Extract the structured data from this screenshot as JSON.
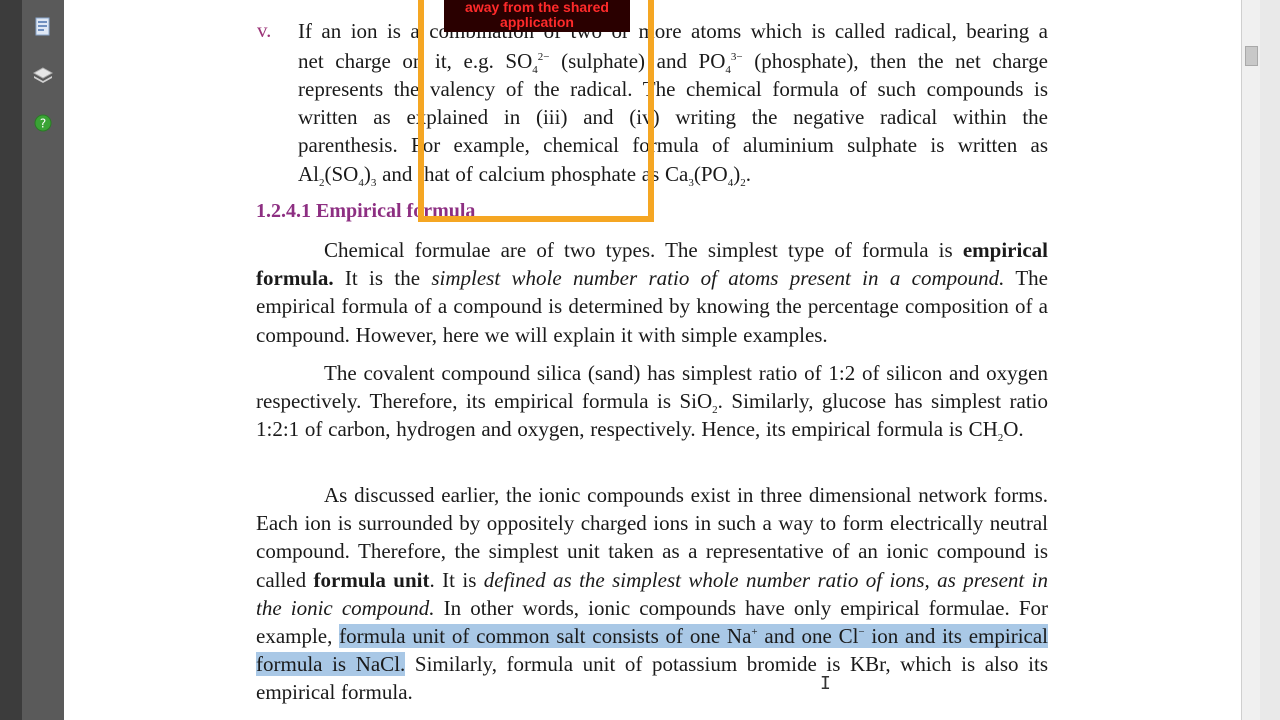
{
  "toolbar": {
    "icons": [
      "page-thumbnails-icon",
      "layers-icon",
      "help-icon"
    ]
  },
  "overlay": {
    "label_line1": "away from the shared",
    "label_line2": "application"
  },
  "item_v": {
    "marker": "v.",
    "l1": "If an ion is a combination of two or more atoms which is called radical, bearing a",
    "l2a": "net charge on it, e.g. SO",
    "l2_sub": "4",
    "l2_sup": "2−",
    "l2b": " (sulphate) and PO",
    "l2_sub2": "4",
    "l2_sup2": "3−",
    "l2c": " (phosphate), then the net charge",
    "l3": "represents the valency of the radical. The chemical formula of such compounds is",
    "l4": "written as explained in (iii) and (iv) writing the negative radical within the",
    "l5": "parenthesis. For example, chemical formula of aluminium sulphate is written as",
    "l6a": "Al",
    "l6_sub1": "2",
    "l6b": "(SO",
    "l6_sub2": "4",
    "l6c": ")",
    "l6_sub3": "3",
    "l6d": " and that of calcium phosphate as Ca",
    "l6_sub4": "3",
    "l6e": "(PO",
    "l6_sub5": "4",
    "l6f": ")",
    "l6_sub6": "2",
    "l6g": "."
  },
  "heading": "1.2.4.1 Empirical formula",
  "p1": {
    "a": "Chemical formulae are of two types. The simplest type of formula is ",
    "b": "empirical formula.",
    "c": " It is the ",
    "d": "simplest whole number ratio of atoms present in a compound.",
    "e": " The empirical formula of a compound is determined by knowing the percentage composition of a compound. However, here we will explain it with simple examples."
  },
  "p2": {
    "a": "The covalent compound silica (sand) has simplest ratio of 1:2 of silicon and oxygen respectively. Therefore, its empirical formula is SiO",
    "sub1": "2",
    "b": ". Similarly, glucose has simplest ratio 1:2:1 of carbon, hydrogen and oxygen, respectively. Hence, its empirical formula is CH",
    "sub2": "2",
    "c": "O."
  },
  "p3": {
    "a": "As discussed earlier, the ionic compounds exist in three dimensional network forms. Each ion is surrounded by oppositely charged ions in such a way to form electrically neutral compound. Therefore, the simplest unit taken as a representative of an ionic compound is called ",
    "b": "formula unit",
    "c": ". It is ",
    "d": "defined as the simplest whole number ratio of ions, as present in the ionic compound.",
    "e": " In other words, ionic compounds have only empirical formulae. For example, ",
    "hl1": "formula unit of common salt consists of one Na",
    "hl_sup1": "+",
    "hl2": " and one Cl",
    "hl_sup2": "−",
    "hl3": " ion and its empirical formula is NaCl.",
    "f": " Similarly, formula unit of potassium bromide is KBr, which is also its empirical formula."
  },
  "colors": {
    "heading": "#8d2f82",
    "highlight": "#a9c8e6",
    "frame": "#f5a623"
  }
}
